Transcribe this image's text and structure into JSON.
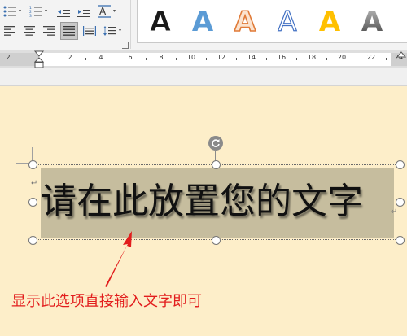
{
  "ribbon": {
    "paragraph_tools": [
      {
        "name": "bullet-list-icon"
      },
      {
        "name": "numbered-list-icon"
      },
      {
        "name": "decrease-indent-icon"
      },
      {
        "name": "increase-indent-icon"
      },
      {
        "name": "text-direction-icon"
      },
      {
        "name": "align-left-icon"
      },
      {
        "name": "align-center-icon"
      },
      {
        "name": "align-right-icon"
      },
      {
        "name": "justify-icon"
      },
      {
        "name": "distributed-icon"
      },
      {
        "name": "line-spacing-icon"
      }
    ],
    "wordart_styles": [
      {
        "letter": "A",
        "fill": "#1a1a1a",
        "stroke": "#ffffff",
        "style": "black-bold"
      },
      {
        "letter": "A",
        "fill": "#5b9bd5",
        "stroke": "#5b9bd5",
        "style": "blue-solid"
      },
      {
        "letter": "A",
        "fill": "#f4b183",
        "stroke": "#c55a11",
        "style": "orange-outline"
      },
      {
        "letter": "A",
        "fill": "#ffffff",
        "stroke": "#4472c4",
        "style": "white-blue-outline"
      },
      {
        "letter": "A",
        "fill": "#ffc000",
        "stroke": "#ffc000",
        "style": "gold-solid"
      },
      {
        "letter": "A",
        "fill": "#707070",
        "stroke": "#404040",
        "style": "grey-gradient"
      }
    ]
  },
  "ruler": {
    "numbers": [
      "2",
      "2",
      "4",
      "6",
      "8",
      "10",
      "12",
      "14",
      "16",
      "18",
      "20",
      "22",
      "24"
    ]
  },
  "document": {
    "wordart_text": "请在此放置您的文字",
    "annotation": "显示此选项直接输入文字即可",
    "paragraph_mark": "↵"
  },
  "colors": {
    "annotation": "#e21d1d",
    "page_background": "#fdeec9",
    "selection": "#c6bd9e"
  }
}
